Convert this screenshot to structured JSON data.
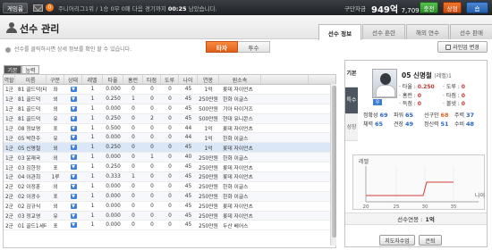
{
  "topbar": {
    "game_label": "게임룸",
    "badge": "0",
    "league_info": "주니어리그1위 / 1승 0무 0패",
    "time_info_prefix": "다음 경기까지",
    "time_info_value": "00:25",
    "time_info_suffix": "남았습니다.",
    "cash_label": "구단자금",
    "cash_main": "949억",
    "cash_sub": "7,709만원",
    "charge_label": "충전",
    "store_label": "상점",
    "shop_label": "숍"
  },
  "header": {
    "title": "선수 관리",
    "tabs": [
      "선수 정보",
      "선수 훈련",
      "해외 연수",
      "선수 판매"
    ]
  },
  "info_text": "선수를 클릭하시면 상세 정보를 확인 할 수 있습니다.",
  "toggle": {
    "on": "타자",
    "off": "투수"
  },
  "lineup_button": "라인업 변경",
  "subtabs": [
    "기본",
    "능력"
  ],
  "table": {
    "columns": [
      "역할",
      "이름",
      "구분",
      "상태",
      "레벨",
      "타율",
      "홈런",
      "타점",
      "도루",
      "나이",
      "연봉",
      "원소속",
      ""
    ],
    "rows": [
      [
        "1군",
        "81 골드덕(타)",
        "좌",
        "",
        "1",
        "0.000",
        "0",
        "0",
        "0",
        "45",
        "1억",
        "롯데 자이언츠"
      ],
      [
        "1군",
        "81 골드덕",
        "외",
        "",
        "1",
        "0.250",
        "1",
        "0",
        "0",
        "45",
        "250만원",
        "한화 이글스"
      ],
      [
        "1군",
        "81 골드덕",
        "외",
        "",
        "1",
        "0.000",
        "0",
        "0",
        "0",
        "45",
        "500만원",
        "기아 타이거즈"
      ],
      [
        "1군",
        "81 골드덕",
        "유",
        "",
        "1",
        "0.250",
        "0",
        "2",
        "0",
        "45",
        "500만원",
        "현대 유니콘스"
      ],
      [
        "1군",
        "08 정보명",
        "포",
        "",
        "1",
        "0.500",
        "0",
        "0",
        "0",
        "44",
        "1억",
        "롯데 자이언츠"
      ],
      [
        "1군",
        "05 박한주",
        "유",
        "",
        "1",
        "0.000",
        "0",
        "0",
        "0",
        "44",
        "1억",
        "한화 이글스"
      ],
      [
        "1군",
        "05 신명철",
        "외",
        "",
        "1",
        "0.250",
        "0",
        "0",
        "0",
        "45",
        "1억",
        "롯데 자이언츠"
      ],
      [
        "1군",
        "03 윤재국",
        "외",
        "",
        "1",
        "0.000",
        "0",
        "1",
        "0",
        "40",
        "250만원",
        "한화 이글스"
      ],
      [
        "1군",
        "03 김한정",
        "포",
        "",
        "1",
        "0.250",
        "0",
        "0",
        "0",
        "45",
        "250만원",
        "롯데 자이언츠"
      ],
      [
        "1군",
        "04 이관희",
        "1루",
        "",
        "1",
        "0.333",
        "1",
        "0",
        "0",
        "45",
        "250만원",
        "롯데 자이언츠"
      ],
      [
        "2군",
        "02 이정훈",
        "외",
        "",
        "1",
        "0.000",
        "0",
        "0",
        "0",
        "45",
        "250만원",
        "한화 이글스"
      ],
      [
        "2군",
        "02 이광수",
        "포",
        "",
        "1",
        "0.000",
        "0",
        "0",
        "0",
        "45",
        "250만원",
        "한화 이글스"
      ],
      [
        "2군",
        "02 김규식",
        "외",
        "",
        "1",
        "0.000",
        "0",
        "0",
        "0",
        "45",
        "250만원",
        "롯데 자이언츠"
      ],
      [
        "2군",
        "03 정교영",
        "유",
        "",
        "1",
        "0.000",
        "0",
        "0",
        "0",
        "45",
        "250만원",
        "롯데 자이언츠"
      ],
      [
        "2군",
        "01 골드1세타",
        "포",
        "",
        "1",
        "0.000",
        "0",
        "0",
        "0",
        "45",
        "250만원",
        "두산 베어스"
      ]
    ]
  },
  "card": {
    "vtabs": [
      "기본",
      "특수",
      "성장"
    ],
    "player_name": "05 신명철",
    "player_sub": "(레벨)1",
    "hand": "우",
    "stats": [
      [
        "타율",
        "0.250"
      ],
      [
        "도루",
        "0"
      ],
      [
        "홈런",
        "0"
      ],
      [
        "타점",
        "0"
      ],
      [
        "득점",
        "0"
      ],
      [
        "볼넷",
        "0"
      ]
    ],
    "abilities": [
      [
        "정확성",
        "69"
      ],
      [
        "파워",
        "65"
      ],
      [
        "선구안",
        "68"
      ],
      [
        "주력",
        "37"
      ],
      [
        "체력",
        "65"
      ],
      [
        "견장",
        "49"
      ],
      [
        "정신력",
        "51"
      ],
      [
        "수비",
        "48"
      ]
    ],
    "chart_y_label": "레벨",
    "chart_x_label": "나이",
    "chart_x_ticks": [
      "20",
      "25",
      "30",
      "35"
    ],
    "salary_label": "선수연봉 :",
    "salary_value": "1억",
    "btn_train": "지도자수업",
    "btn_retire": "은퇴"
  },
  "colors": {
    "accent": "#f07a2a",
    "blue": "#3d7fd8",
    "charge": "#3ea63a"
  }
}
